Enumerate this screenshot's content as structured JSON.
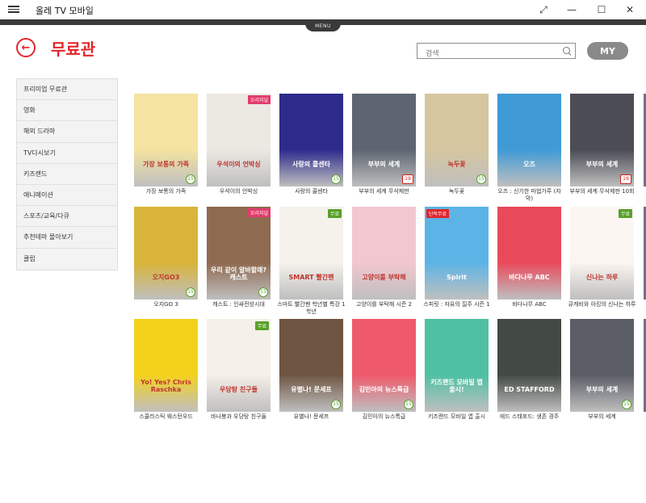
{
  "window": {
    "title": "올레 TV 모바일",
    "menu_tab": "MENU",
    "icons": [
      "hamburger-icon",
      "resize-icon",
      "minimize-icon",
      "maximize-icon",
      "close-icon"
    ]
  },
  "header": {
    "title": "무료관",
    "search_placeholder": "검색",
    "my_label": "MY",
    "accent": "#e2262c"
  },
  "sidebar": {
    "items": [
      {
        "label": "프리미엄 무료관"
      },
      {
        "label": "영화"
      },
      {
        "label": "해외 드라마"
      },
      {
        "label": "TV다시보기"
      },
      {
        "label": "키즈랜드"
      },
      {
        "label": "애니메이션"
      },
      {
        "label": "스포츠/교육/다큐"
      },
      {
        "label": "추천테마 몰아보기"
      },
      {
        "label": "클립"
      }
    ]
  },
  "cards": [
    {
      "caption": "가장 보통의 가족",
      "poster_text": "가장 보통의 가족",
      "age": "15",
      "color": "#f4e3a1"
    },
    {
      "caption": "우석이의 언박싱",
      "poster_text": "우석이의 언박싱",
      "tag": "오리지널",
      "color": "#ece8e2"
    },
    {
      "caption": "사랑의 콜센타",
      "poster_text": "사랑의 콜센타",
      "age": "15",
      "color": "#2d2a8c"
    },
    {
      "caption": "부부의 세계 무삭제판",
      "poster_text": "부부의 세계",
      "age_red": "19",
      "color": "#5c6570"
    },
    {
      "caption": "녹두꽃",
      "poster_text": "녹두꽃",
      "age": "15",
      "color": "#d6c6a0"
    },
    {
      "caption": "오즈 : 신기한 마법가루 (자막)",
      "poster_text": "오즈",
      "color": "#3f9ad6"
    },
    {
      "caption": "부부의 세계 무삭제판 10회",
      "poster_text": "부부의 세계",
      "age_red": "19",
      "color": "#4b4c55"
    },
    {
      "caption": "오지GO 3",
      "poster_text": "오지GO3",
      "age": "15",
      "color": "#d8b53a"
    },
    {
      "caption": "캐스트 : 인싸전성시대",
      "poster_text": "우리 같이 알바할래? 캐스트",
      "tag": "오리지널",
      "age": "15",
      "color": "#8e6a50"
    },
    {
      "caption": "스마트 빨간펜 학년별 특강 1학년",
      "poster_text": "SMART 빨간펜",
      "free": "무료",
      "color": "#f5f2ec"
    },
    {
      "caption": "고양이를 부탁해 시즌 2",
      "poster_text": "고양이를 부탁해",
      "color": "#f2c7cf"
    },
    {
      "caption": "스피릿 : 자유의 질주 시즌 1",
      "poster_text": "Spirit",
      "tag2": "단독무료",
      "color": "#5cb4e6"
    },
    {
      "caption": "바다나무 ABC",
      "poster_text": "바다나무 ABC",
      "color": "#e84a5b"
    },
    {
      "caption": "큐캐비와 아킹의 신나는 하루",
      "poster_text": "신나는 하루",
      "free": "무료",
      "color": "#fbf6f1"
    },
    {
      "caption": "스콜라스틱 웨스턴우드",
      "poster_text": "Yo! Yes? Chris Raschka",
      "color": "#f4d21c"
    },
    {
      "caption": "바나봉과 우당탕 친구들",
      "poster_text": "우당탕 친구들",
      "free": "무료",
      "color": "#f5f0e8"
    },
    {
      "caption": "유별나! 문세프",
      "poster_text": "유별나! 문세프",
      "age": "15",
      "color": "#6e5542"
    },
    {
      "caption": "김민아의 뉴스특급",
      "poster_text": "김민아의 뉴스특급",
      "age": "15",
      "color": "#ef5a6b"
    },
    {
      "caption": "키즈랜드 모바일 앱 출시",
      "poster_text": "키즈랜드 모바일 앱 출시!",
      "color": "#4fc0a4"
    },
    {
      "caption": "에드 스태포드: 생존 경주",
      "poster_text": "ED STAFFORD",
      "color": "#434a44"
    },
    {
      "caption": "부부의 세계",
      "poster_text": "부부의 세계",
      "age": "15",
      "color": "#5b5d66"
    }
  ]
}
